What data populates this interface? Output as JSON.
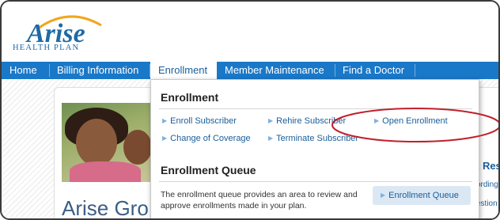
{
  "brand": {
    "logo_word": "Arise",
    "logo_sub": "HEALTH PLAN",
    "primary_color": "#1a78c8",
    "logo_color": "#1d6aa6",
    "callout_color": "#c0202a"
  },
  "nav": {
    "items": [
      {
        "label": "Home"
      },
      {
        "label": "Billing Information"
      },
      {
        "label": "Enrollment"
      },
      {
        "label": "Member Maintenance"
      },
      {
        "label": "Find a Doctor"
      }
    ],
    "active_index": 2
  },
  "dropdown": {
    "enrollment_heading": "Enrollment",
    "links": [
      {
        "label": "Enroll Subscriber"
      },
      {
        "label": "Rehire Subscriber"
      },
      {
        "label": "Open Enrollment"
      },
      {
        "label": "Change of Coverage"
      },
      {
        "label": "Terminate Subscriber"
      }
    ],
    "queue_heading": "Enrollment Queue",
    "queue_description": "The enrollment queue provides an area to review and approve enrollments made in your plan.",
    "queue_button": "Enrollment Queue"
  },
  "page": {
    "title_partial": "Arise Gro",
    "right_partial_heading": "t Res",
    "right_partial_line1": "ording",
    "right_partial_line2": "estion"
  },
  "icons": {
    "link_arrow": "right-triangle-icon"
  }
}
